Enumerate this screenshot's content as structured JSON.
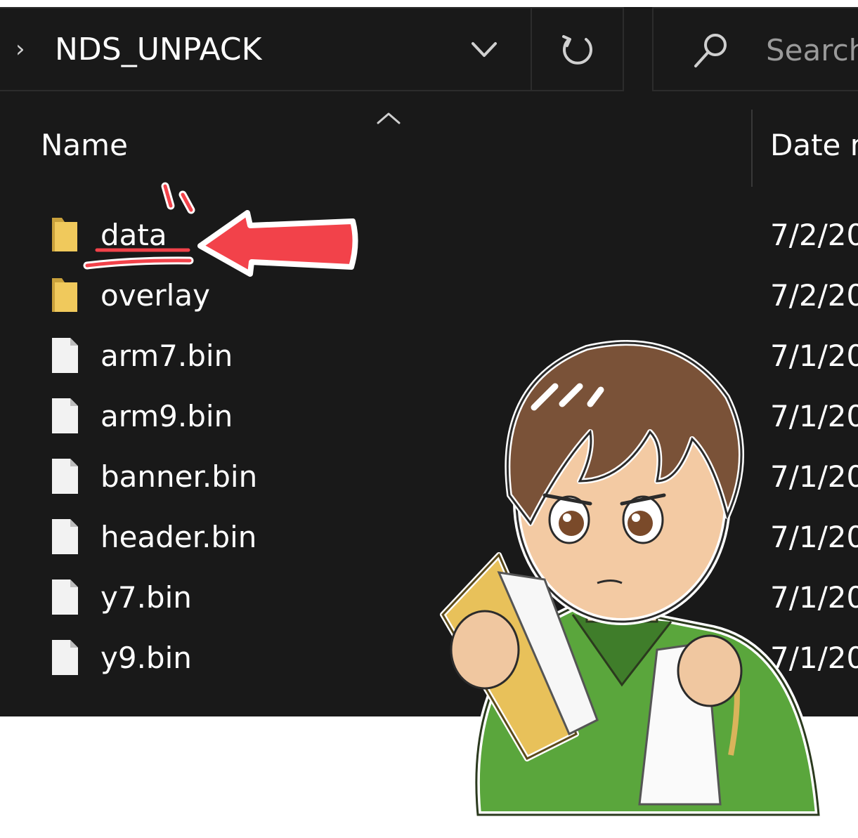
{
  "address": {
    "path": "NDS_UNPACK"
  },
  "search": {
    "placeholder": "Search"
  },
  "columns": {
    "name": "Name",
    "date": "Date m"
  },
  "files": [
    {
      "name": "data",
      "type": "folder",
      "date": "7/2/20"
    },
    {
      "name": "overlay",
      "type": "folder",
      "date": "7/2/20"
    },
    {
      "name": "arm7.bin",
      "type": "file",
      "date": "7/1/20"
    },
    {
      "name": "arm9.bin",
      "type": "file",
      "date": "7/1/20"
    },
    {
      "name": "banner.bin",
      "type": "file",
      "date": "7/1/20"
    },
    {
      "name": "header.bin",
      "type": "file",
      "date": "7/1/20"
    },
    {
      "name": "y7.bin",
      "type": "file",
      "date": "7/1/20"
    },
    {
      "name": "y9.bin",
      "type": "file",
      "date": "7/1/20"
    }
  ],
  "colors": {
    "background": "#191919",
    "folder": "#e8c15a",
    "annotation": "#f2424a",
    "text": "#ffffff"
  },
  "icons": {
    "breadcrumb": "chevron-right-icon",
    "dropdown": "chevron-down-icon",
    "refresh": "refresh-icon",
    "search": "search-icon",
    "sort": "sort-up-icon",
    "folder": "folder-icon",
    "file": "file-icon"
  }
}
